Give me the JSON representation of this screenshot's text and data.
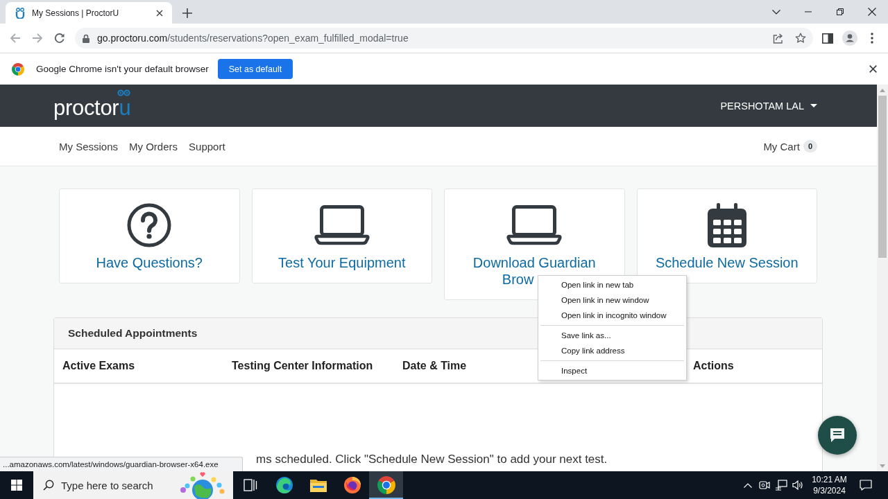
{
  "browser": {
    "tabs": [
      {
        "title": "My Sessions | ProctorU",
        "selected": true
      }
    ],
    "address": {
      "host": "go.proctoru.com",
      "path": "/students/reservations?open_exam_fulfilled_modal=true"
    },
    "infobar": {
      "message": "Google Chrome isn't your default browser",
      "button": "Set as default"
    }
  },
  "header": {
    "logo": {
      "word": "proctor",
      "accent": "u"
    },
    "user": "PERSHOTAM LAL"
  },
  "nav": {
    "links": [
      "My Sessions",
      "My Orders",
      "Support"
    ],
    "cart": {
      "label": "My Cart",
      "count": "0"
    }
  },
  "cards": [
    {
      "kind": "question",
      "title_lines": [
        "Have Questions?"
      ]
    },
    {
      "kind": "laptop",
      "title_lines": [
        "Test Your Equipment"
      ]
    },
    {
      "kind": "laptop",
      "title_lines": [
        "Download Guardian",
        "Brow"
      ]
    },
    {
      "kind": "calendar",
      "title_lines": [
        "Schedule New Session"
      ]
    }
  ],
  "appointments": {
    "title": "Scheduled Appointments",
    "columns": [
      "Active Exams",
      "Testing Center Information",
      "Date & Time",
      "Actions"
    ],
    "empty_message": "ms scheduled. Click \"Schedule New Session\" to add your next test."
  },
  "context_menu": {
    "groups": [
      [
        "Open link in new tab",
        "Open link in new window",
        "Open link in incognito window"
      ],
      [
        "Save link as...",
        "Copy link address"
      ],
      [
        "Inspect"
      ]
    ]
  },
  "status_bubble": "...amazonaws.com/latest/windows/guardian-browser-x64.exe",
  "taskbar": {
    "search": {
      "placeholder": "Type here to search"
    },
    "apps": [
      {
        "kind": "task-view",
        "selected": false
      },
      {
        "kind": "edge",
        "selected": false
      },
      {
        "kind": "explorer",
        "selected": false
      },
      {
        "kind": "firefox",
        "selected": false
      },
      {
        "kind": "chrome",
        "selected": true
      }
    ],
    "time": "10:21 AM",
    "date": "9/3/2024"
  }
}
